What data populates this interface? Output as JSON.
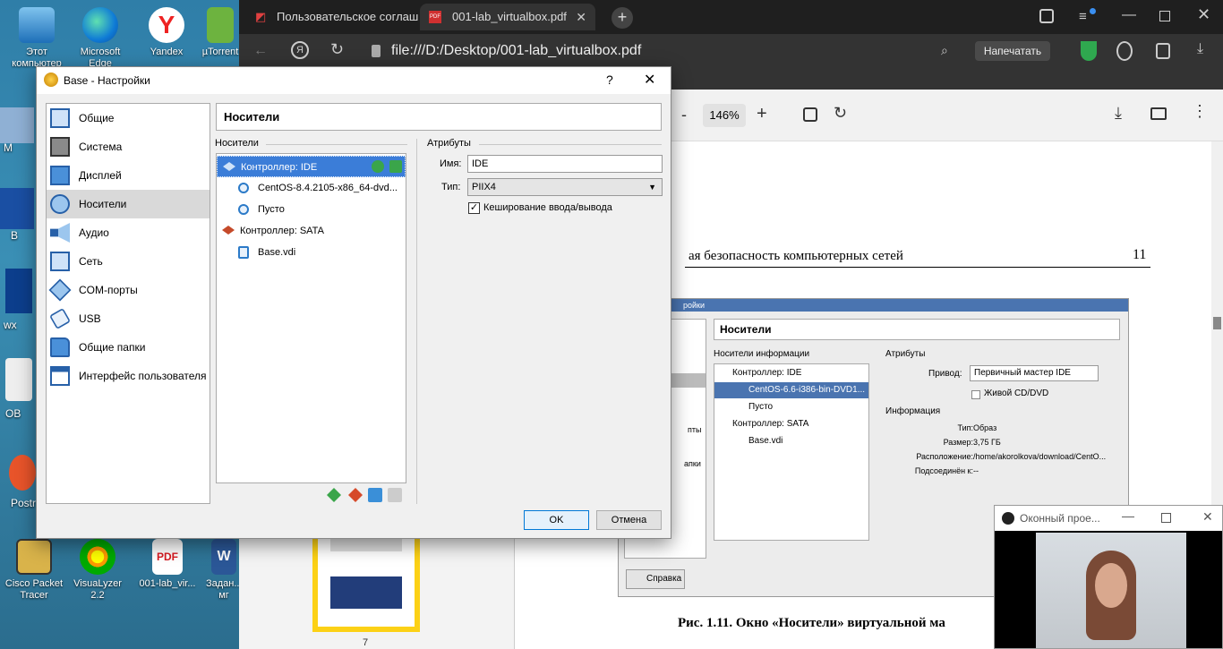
{
  "desktop": {
    "icons": [
      {
        "label": "Этот компьютер",
        "icon": "computer-icon"
      },
      {
        "label": "Microsoft Edge",
        "icon": "edge-icon"
      },
      {
        "label": "Yandex",
        "icon": "yandex-icon"
      },
      {
        "label": "µTorrent",
        "icon": "utorrent-icon"
      },
      {
        "label": "Cisco Packet Tracer",
        "icon": "cisco-icon"
      },
      {
        "label": "VisuaLyzer 2.2",
        "icon": "visualyzer-icon"
      },
      {
        "label": "001-lab_vir...",
        "icon": "pdf-file-icon"
      },
      {
        "label": "Задан... мг",
        "icon": "word-icon"
      }
    ],
    "side_labels": {
      "m": "M",
      "b": "B",
      "wx": "wx",
      "ob": "OB",
      "postr": "Postr"
    }
  },
  "browser": {
    "tabs": [
      {
        "title": "Пользовательское соглаш",
        "icon": "mail-icon"
      },
      {
        "title": "001-lab_virtualbox.pdf",
        "icon": "pdf-icon",
        "active": true
      }
    ],
    "address": "file:///D:/Desktop/001-lab_virtualbox.pdf",
    "print_label": "Напечатать",
    "zoom": "146%",
    "page_heading": "ая безопасность компьютерных сетей",
    "page_number": "11",
    "thumb_page_number": "7",
    "figure_caption": "Рис. 1.11. Окно «Носители» виртуальной ма",
    "embedded": {
      "title": "ройки",
      "header": "Носители",
      "left_group": "Носители информации",
      "right_group": "Атрибуты",
      "tree": [
        {
          "label": "Контроллер: IDE"
        },
        {
          "label": "CentOS-6.6-i386-bin-DVD1..."
        },
        {
          "label": "Пусто"
        },
        {
          "label": "Контроллер: SATA"
        },
        {
          "label": "Base.vdi"
        }
      ],
      "drive_label": "Привод:",
      "drive_value": "Первичный мастер IDE",
      "live_cd": "Живой CD/DVD",
      "info_group": "Информация",
      "info": [
        {
          "k": "Тип:",
          "v": "Образ"
        },
        {
          "k": "Размер:",
          "v": "3,75 ГБ"
        },
        {
          "k": "Расположение:",
          "v": "/home/akorolkova/download/CentO..."
        },
        {
          "k": "Подсоединён к:",
          "v": "--"
        }
      ],
      "left_partial_1": "пты",
      "left_partial_2": "апки",
      "help": "Справка"
    }
  },
  "dialog": {
    "title": "Base - Настройки",
    "help_glyph": "?",
    "close_glyph": "✕",
    "nav": [
      {
        "label": "Общие",
        "icon": "general-icon"
      },
      {
        "label": "Система",
        "icon": "system-icon"
      },
      {
        "label": "Дисплей",
        "icon": "display-icon"
      },
      {
        "label": "Носители",
        "icon": "storage-icon",
        "selected": true
      },
      {
        "label": "Аудио",
        "icon": "audio-icon"
      },
      {
        "label": "Сеть",
        "icon": "network-icon"
      },
      {
        "label": "COM-порты",
        "icon": "serial-ports-icon"
      },
      {
        "label": "USB",
        "icon": "usb-icon"
      },
      {
        "label": "Общие папки",
        "icon": "shared-folders-icon"
      },
      {
        "label": "Интерфейс пользователя",
        "icon": "user-interface-icon"
      }
    ],
    "section_header": "Носители",
    "storage_group": "Носители",
    "attributes_group": "Атрибуты",
    "tree": [
      {
        "label": "Контроллер: IDE",
        "selected": true
      },
      {
        "label": "CentOS-8.4.2105-x86_64-dvd..."
      },
      {
        "label": "Пусто"
      },
      {
        "label": "Контроллер: SATA"
      },
      {
        "label": "Base.vdi"
      }
    ],
    "name_label": "Имя:",
    "name_value": "IDE",
    "type_label": "Тип:",
    "type_value": "PIIX4",
    "cache_label": "Кеширование ввода/вывода",
    "cache_checked": true,
    "ok": "OK",
    "cancel": "Отмена"
  },
  "webcam": {
    "title": "Оконный прое..."
  }
}
